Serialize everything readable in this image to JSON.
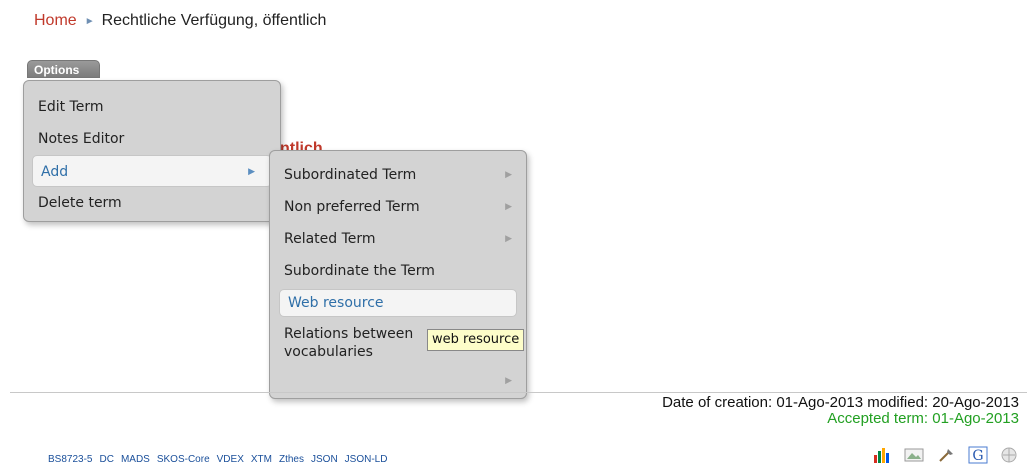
{
  "breadcrumb": {
    "home": "Home",
    "separator": "►",
    "current": "Rechtliche Verfügung, öffentlich"
  },
  "options_button": "Options",
  "term_title_partial": "ntlich",
  "main_menu": {
    "edit_term": "Edit Term",
    "notes_editor": "Notes Editor",
    "add": "Add",
    "delete_term": "Delete term"
  },
  "sub_menu": {
    "subordinated_term": "Subordinated Term",
    "non_preferred_term": "Non preferred Term",
    "related_term": "Related Term",
    "subordinate_the_term": "Subordinate the Term",
    "web_resource": "Web resource",
    "relations_line1": "Relations between",
    "relations_line2": "vocabularies"
  },
  "tooltip": "web resource",
  "dates": {
    "creation": "Date of creation: 01-Ago-2013",
    "modified": "modified: 20-Ago-2013",
    "accepted": "Accepted term: 01-Ago-2013"
  },
  "formats": [
    "BS8723-5",
    "DC",
    "MADS",
    "SKOS-Core",
    "VDEX",
    "XTM",
    "Zthes",
    "JSON",
    "JSON-LD"
  ],
  "icons": [
    "bar-chart-icon",
    "image-icon",
    "tools-icon",
    "google-icon",
    "globe-icon"
  ],
  "colors": {
    "home_link": "#c0392b",
    "accepted": "#22a022",
    "highlight_text": "#2f6fa8",
    "format_link": "#1a4f9a"
  }
}
